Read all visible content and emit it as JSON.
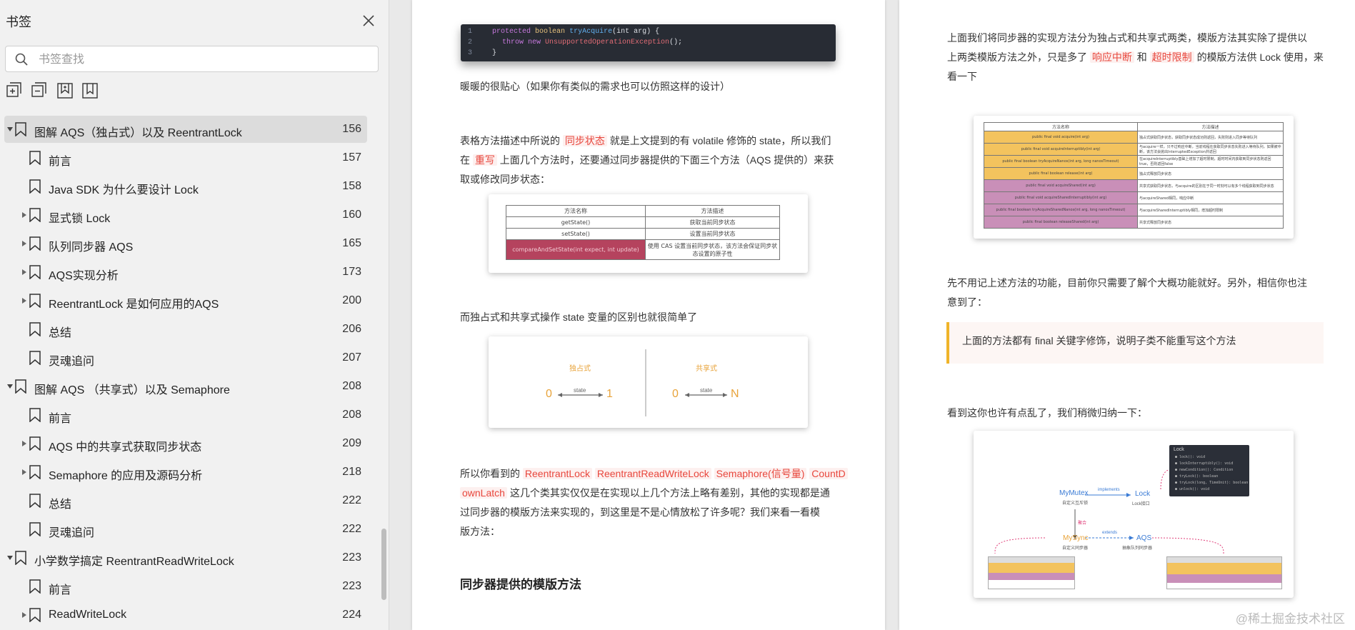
{
  "sidebar": {
    "title": "书签",
    "search_placeholder": "书签查找",
    "items": [
      {
        "label": "图解 AQS（独占式）以及 ReentrantLock",
        "page": "156",
        "level": 0,
        "expander": "expanded",
        "selected": true
      },
      {
        "label": "前言",
        "page": "157",
        "level": 1,
        "expander": "none"
      },
      {
        "label": "Java SDK 为什么要设计 Lock",
        "page": "158",
        "level": 1,
        "expander": "none"
      },
      {
        "label": "显式锁 Lock",
        "page": "160",
        "level": 1,
        "expander": "collapsed"
      },
      {
        "label": "队列同步器 AQS",
        "page": "165",
        "level": 1,
        "expander": "collapsed"
      },
      {
        "label": "AQS实现分析",
        "page": "173",
        "level": 1,
        "expander": "collapsed"
      },
      {
        "label": "ReentrantLock 是如何应用的AQS",
        "page": "200",
        "level": 1,
        "expander": "collapsed"
      },
      {
        "label": "总结",
        "page": "206",
        "level": 1,
        "expander": "none"
      },
      {
        "label": "灵魂追问",
        "page": "207",
        "level": 1,
        "expander": "none"
      },
      {
        "label": "图解 AQS （共享式）以及 Semaphore",
        "page": "208",
        "level": 0,
        "expander": "expanded"
      },
      {
        "label": "前言",
        "page": "208",
        "level": 1,
        "expander": "none"
      },
      {
        "label": "AQS 中的共享式获取同步状态",
        "page": "209",
        "level": 1,
        "expander": "collapsed"
      },
      {
        "label": "Semaphore 的应用及源码分析",
        "page": "218",
        "level": 1,
        "expander": "collapsed"
      },
      {
        "label": "总结",
        "page": "222",
        "level": 1,
        "expander": "none"
      },
      {
        "label": "灵魂追问",
        "page": "222",
        "level": 1,
        "expander": "none"
      },
      {
        "label": "小学数学搞定 ReentrantReadWriteLock",
        "page": "223",
        "level": 0,
        "expander": "expanded"
      },
      {
        "label": "前言",
        "page": "223",
        "level": 1,
        "expander": "none"
      },
      {
        "label": "ReadWriteLock",
        "page": "224",
        "level": 1,
        "expander": "collapsed"
      }
    ]
  },
  "page1": {
    "code_lines": [
      {
        "n": "1",
        "kw": "protected",
        "ty": "boolean",
        "fn": "tryAcquire",
        "rest": "(int arg) {"
      },
      {
        "n": "2",
        "kw": "throw new",
        "cls": "UnsupportedOperationException",
        "rest": "();"
      },
      {
        "n": "3",
        "rest": "}"
      }
    ],
    "para1": "暖暖的很贴心（如果你有类似的需求也可以仿照这样的设计）",
    "para2_a": "表格方法描述中所说的",
    "para2_hl1": "同步状态",
    "para2_b": "就是上文提到的有 volatile 修饰的 state，所以我们",
    "para2_c": "在",
    "para2_hl2": "重写",
    "para2_d": "上面几个方法时，还要通过同步器提供的下面三个方法（AQS 提供的）来获",
    "para2_e": "取或修改同步状态：",
    "table1": {
      "headers": [
        "方法名称",
        "方法描述"
      ],
      "rows": [
        [
          "getState()",
          "获取当前同步状态"
        ],
        [
          "setState()",
          "设置当前同步状态"
        ],
        [
          "compareAndSetState(int expect, int update)",
          "使用 CAS 设置当前同步状态，该方法会保证同步状态设置的原子性"
        ]
      ]
    },
    "para3": "而独占式和共享式操作 state 变量的区别也就很简单了",
    "fig2": {
      "left_title": "独占式",
      "left_from": "0",
      "left_to": "1",
      "right_title": "共享式",
      "right_from": "0",
      "right_to": "N",
      "arrow_label": "state"
    },
    "para4_a": "所以你看到的",
    "para4_hl": [
      "ReentrantLock",
      "ReentrantReadWriteLock",
      "Semaphore(信号量)",
      "CountD"
    ],
    "para4_hl5": "ownLatch",
    "para4_b": "这几个类其实仅仅是在实现以上几个方法上略有差别，其他的实现都是通",
    "para4_c": "过同步器的模版方法来实现的，到这里是不是心情放松了许多呢？我们来看一看模",
    "para4_d": "版方法：",
    "heading": "同步器提供的模版方法"
  },
  "page2": {
    "para1_a": "上面我们将同步器的实现方法分为独占式和共享式两类，模版方法其实除了提供以",
    "para1_b": "上两类模版方法之外，只是多了",
    "para1_hl1": "响应中断",
    "para1_c": "和",
    "para1_hl2": "超时限制",
    "para1_d": "的模版方法供 Lock 使用，来",
    "para1_e": "看一下",
    "table2": {
      "headers": [
        "方法名称",
        "方法描述"
      ],
      "rows": [
        [
          "public final void acquire(int arg)",
          "独占式获取同步状态，获取同步状态成功则返回，失败则进入同步等待队列",
          "#f3c35e"
        ],
        [
          "public final void acquireInterruptibly(int arg)",
          "与acquire一样，只不过响应中断，当前线程在获取同步状态失败进入等待队列，如果被中断，该方法会抛出InterruptedException并返回",
          "#f3c35e"
        ],
        [
          "public final boolean tryAcquireNanos(int arg, long nanosTimeout)",
          "在acquireInterruptibly基础上增加了超时限制，超时时间内获取到同步状态则返回true，否则返回false",
          "#f3c35e"
        ],
        [
          "public final boolean release(int arg)",
          "独占式释放同步状态",
          "#f3c35e"
        ],
        [
          "public final void acquireShared(int arg)",
          "共享式获取同步状态，与acquire的区别在于同一时刻可以有多个线程获取到同步状态",
          "#c98fb8"
        ],
        [
          "public final void acquireSharedInterruptibly(int arg)",
          "与acquireShared相同，响应中断",
          "#c98fb8"
        ],
        [
          "public final boolean tryAcquireSharedNanos(int arg, long nanosTimeout)",
          "与acquireSharedInterruptibly相同，增加超时限制",
          "#c98fb8"
        ],
        [
          "public final boolean releaseShared(int arg)",
          "共享式释放同步状态",
          "#c98fb8"
        ]
      ]
    },
    "para2_a": "先不用记上述方法的功能，目前你只需要了解个大概功能就好。另外，相信你也注",
    "para2_b": "意到了：",
    "quote": "上面的方法都有 final 关键字修饰，说明子类不能重写这个方法",
    "para3": "看到这你也许有点乱了，我们稍微归纳一下：",
    "fig3": {
      "mymutex": "MyMutex",
      "mymutex_sub": "自定义互斥锁",
      "implements": "implements",
      "lock": "Lock",
      "lock_sub": "Lock接口",
      "mysync": "MySync",
      "mysync_sub": "自定义同步器",
      "extends": "extends",
      "aqs": "AQS",
      "aqs_sub": "抽象队列同步器",
      "aggregate": "聚合",
      "lock_panel_title": "Lock",
      "lock_methods": [
        "lock(): void",
        "lockInterruptibly(): void",
        "newCondition(): Condition",
        "tryLock(): boolean",
        "tryLock(long, TimeUnit): boolean",
        "unlock(): void"
      ]
    }
  },
  "watermark": "@稀土掘金技术社区",
  "colors": {
    "highlight_red": "#e8473d",
    "quote_border": "#f0b429",
    "exclusive_yellow": "#f3c35e",
    "shared_purple": "#c98fb8",
    "cas_red": "#b5435e"
  }
}
